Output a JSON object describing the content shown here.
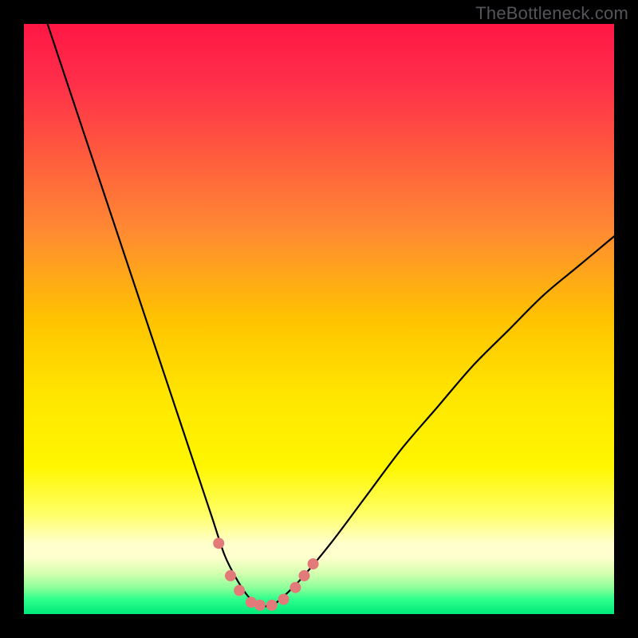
{
  "watermark": "TheBottleneck.com",
  "gradient": {
    "stops": [
      {
        "offset": 0.0,
        "color": "#ff1744"
      },
      {
        "offset": 0.1,
        "color": "#ff2f4a"
      },
      {
        "offset": 0.22,
        "color": "#ff5a3e"
      },
      {
        "offset": 0.35,
        "color": "#ff8a33"
      },
      {
        "offset": 0.5,
        "color": "#ffc300"
      },
      {
        "offset": 0.63,
        "color": "#ffe600"
      },
      {
        "offset": 0.75,
        "color": "#fff600"
      },
      {
        "offset": 0.83,
        "color": "#ffff66"
      },
      {
        "offset": 0.88,
        "color": "#ffffcc"
      },
      {
        "offset": 0.905,
        "color": "#fdffcc"
      },
      {
        "offset": 0.93,
        "color": "#d6ffb0"
      },
      {
        "offset": 0.955,
        "color": "#8eff9a"
      },
      {
        "offset": 0.975,
        "color": "#2eff8c"
      },
      {
        "offset": 1.0,
        "color": "#00e97a"
      }
    ]
  },
  "chart_data": {
    "type": "line",
    "title": "",
    "xlabel": "",
    "ylabel": "",
    "xlim": [
      0,
      100
    ],
    "ylim": [
      0,
      100
    ],
    "series": [
      {
        "name": "bottleneck-curve",
        "x": [
          4,
          10,
          15,
          20,
          25,
          28,
          30,
          32,
          34,
          36,
          38,
          40,
          42,
          44,
          47,
          52,
          58,
          64,
          70,
          76,
          82,
          88,
          94,
          100
        ],
        "y": [
          100,
          82,
          67,
          52,
          37,
          28,
          22,
          16,
          10,
          6,
          3,
          1.5,
          1.5,
          3,
          6,
          12,
          20,
          28,
          35,
          42,
          48,
          54,
          59,
          64
        ]
      }
    ],
    "markers": {
      "name": "highlight-dots",
      "color": "#e37a7a",
      "points": [
        {
          "x": 33.0,
          "y": 12.0
        },
        {
          "x": 35.0,
          "y": 6.5
        },
        {
          "x": 36.5,
          "y": 4.0
        },
        {
          "x": 38.5,
          "y": 2.0
        },
        {
          "x": 40.0,
          "y": 1.5
        },
        {
          "x": 42.0,
          "y": 1.5
        },
        {
          "x": 44.0,
          "y": 2.5
        },
        {
          "x": 46.0,
          "y": 4.5
        },
        {
          "x": 47.5,
          "y": 6.5
        },
        {
          "x": 49.0,
          "y": 8.5
        }
      ]
    }
  }
}
